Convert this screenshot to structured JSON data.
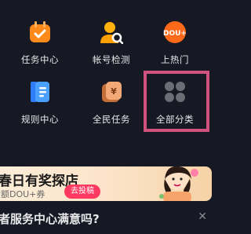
{
  "grid": {
    "items": [
      {
        "label": "任务中心",
        "icon": "task-calendar-icon"
      },
      {
        "label": "帐号检测",
        "icon": "account-check-icon"
      },
      {
        "label": "上热门",
        "icon": "dou-plus-icon"
      },
      {
        "label": "规则中心",
        "icon": "rules-book-icon"
      },
      {
        "label": "全民任务",
        "icon": "money-bag-icon"
      },
      {
        "label": "全部分类",
        "icon": "all-categories-icon"
      }
    ]
  },
  "banner": {
    "title": "春日有奖探店",
    "subtitle": "大额DOU+券",
    "button": "去投稿"
  },
  "survey": {
    "question": "者服务中心满意吗?",
    "close": "✕"
  },
  "colors": {
    "background": "#161823",
    "accent_orange": "#ff7a1a",
    "highlight": "#d1527c",
    "banner_button": "#ff3a62"
  }
}
